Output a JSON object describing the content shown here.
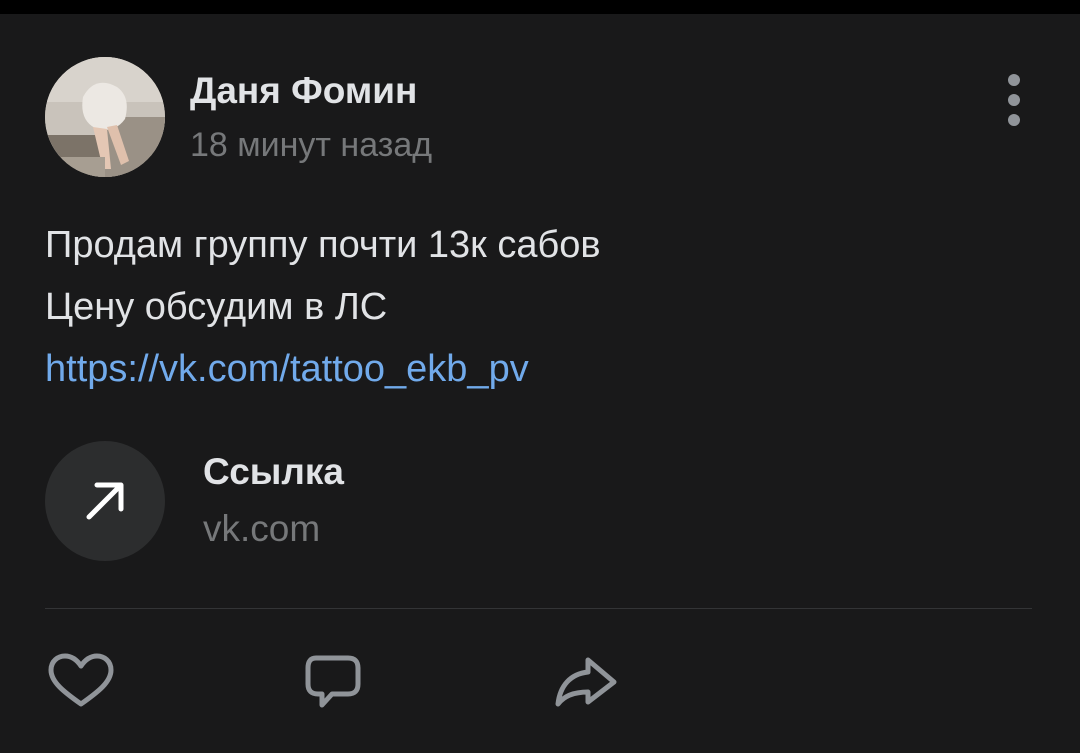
{
  "post": {
    "author": {
      "name": "Даня Фомин",
      "avatar_icon": "user-photo"
    },
    "time": "18 минут назад",
    "text": {
      "line1": "Продам группу почти 13к сабов",
      "line2": "Цену обсудим в ЛС",
      "link": "https://vk.com/tattoo_ekb_pv"
    },
    "attachment": {
      "title": "Ссылка",
      "domain": "vk.com",
      "icon": "arrow-up-right-icon"
    },
    "actions": {
      "like_icon": "heart-icon",
      "comment_icon": "comment-icon",
      "share_icon": "share-icon"
    },
    "colors": {
      "background": "#19191a",
      "text_primary": "#e1e3e6",
      "text_secondary": "#76787a",
      "link": "#71aaeb",
      "icon": "#909499"
    }
  }
}
